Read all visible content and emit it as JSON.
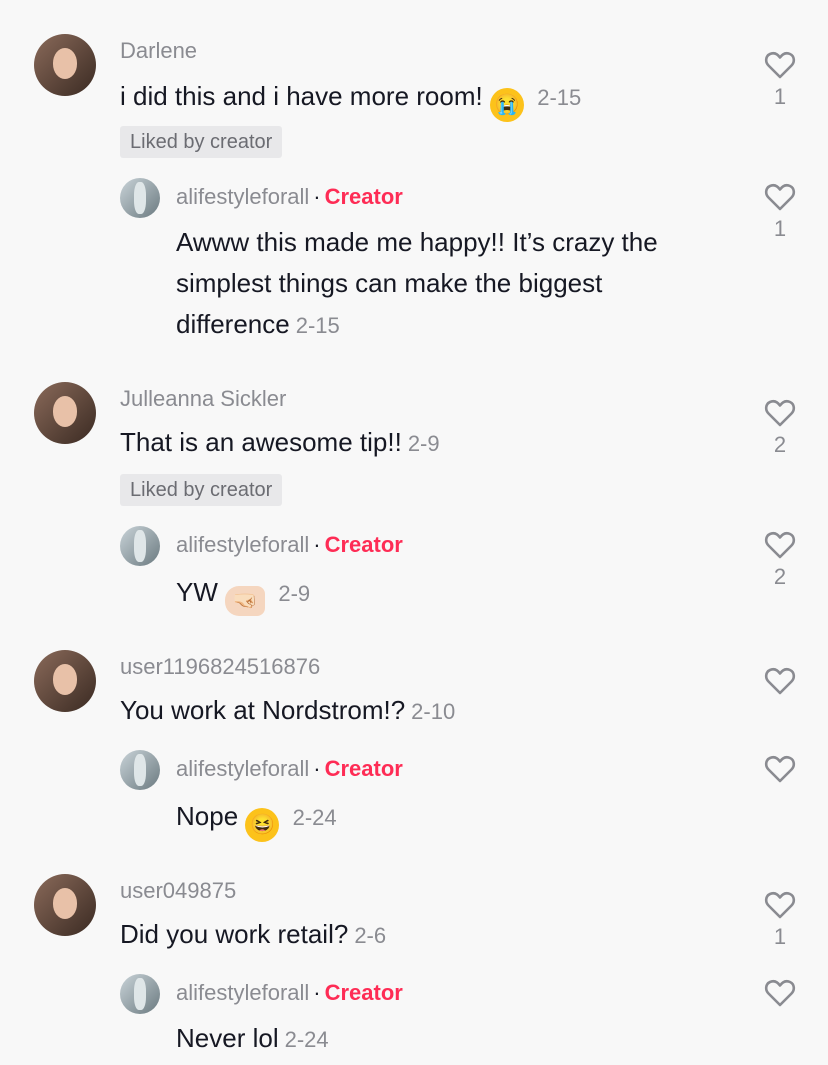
{
  "comments": [
    {
      "author": "Darlene",
      "text": "i did this and i have more room!",
      "emoji": "😭",
      "date": "2-15",
      "liked_by_creator": "Liked by creator",
      "likes": "1",
      "reply": {
        "author": "alifestyleforall",
        "creator_badge": "Creator",
        "text_lines": [
          "Awww this made me happy!! It’s crazy the",
          "simplest things can make the biggest",
          "difference"
        ],
        "date": "2-15",
        "likes": "1"
      }
    },
    {
      "author": "Julleanna Sickler",
      "text": "That is an awesome tip!!",
      "date": "2-9",
      "liked_by_creator": "Liked by creator",
      "likes": "2",
      "reply": {
        "author": "alifestyleforall",
        "creator_badge": "Creator",
        "text": "YW",
        "emoji": "🤜🏻",
        "date": "2-9",
        "likes": "2"
      }
    },
    {
      "author": "user1196824516876",
      "text": "You work at Nordstrom!?",
      "date": "2-10",
      "reply": {
        "author": "alifestyleforall",
        "creator_badge": "Creator",
        "text": "Nope",
        "emoji": "😆",
        "date": "2-24"
      }
    },
    {
      "author": "user049875",
      "text": "Did you work retail?",
      "date": "2-6",
      "likes": "1",
      "reply": {
        "author": "alifestyleforall",
        "creator_badge": "Creator",
        "text": "Never lol",
        "date": "2-24"
      }
    }
  ],
  "icons": {
    "like": "heart-outline-icon"
  },
  "colors": {
    "creator": "#fe2c55",
    "meta": "#8a8b91",
    "text": "#161823",
    "background": "#f8f8f8"
  }
}
